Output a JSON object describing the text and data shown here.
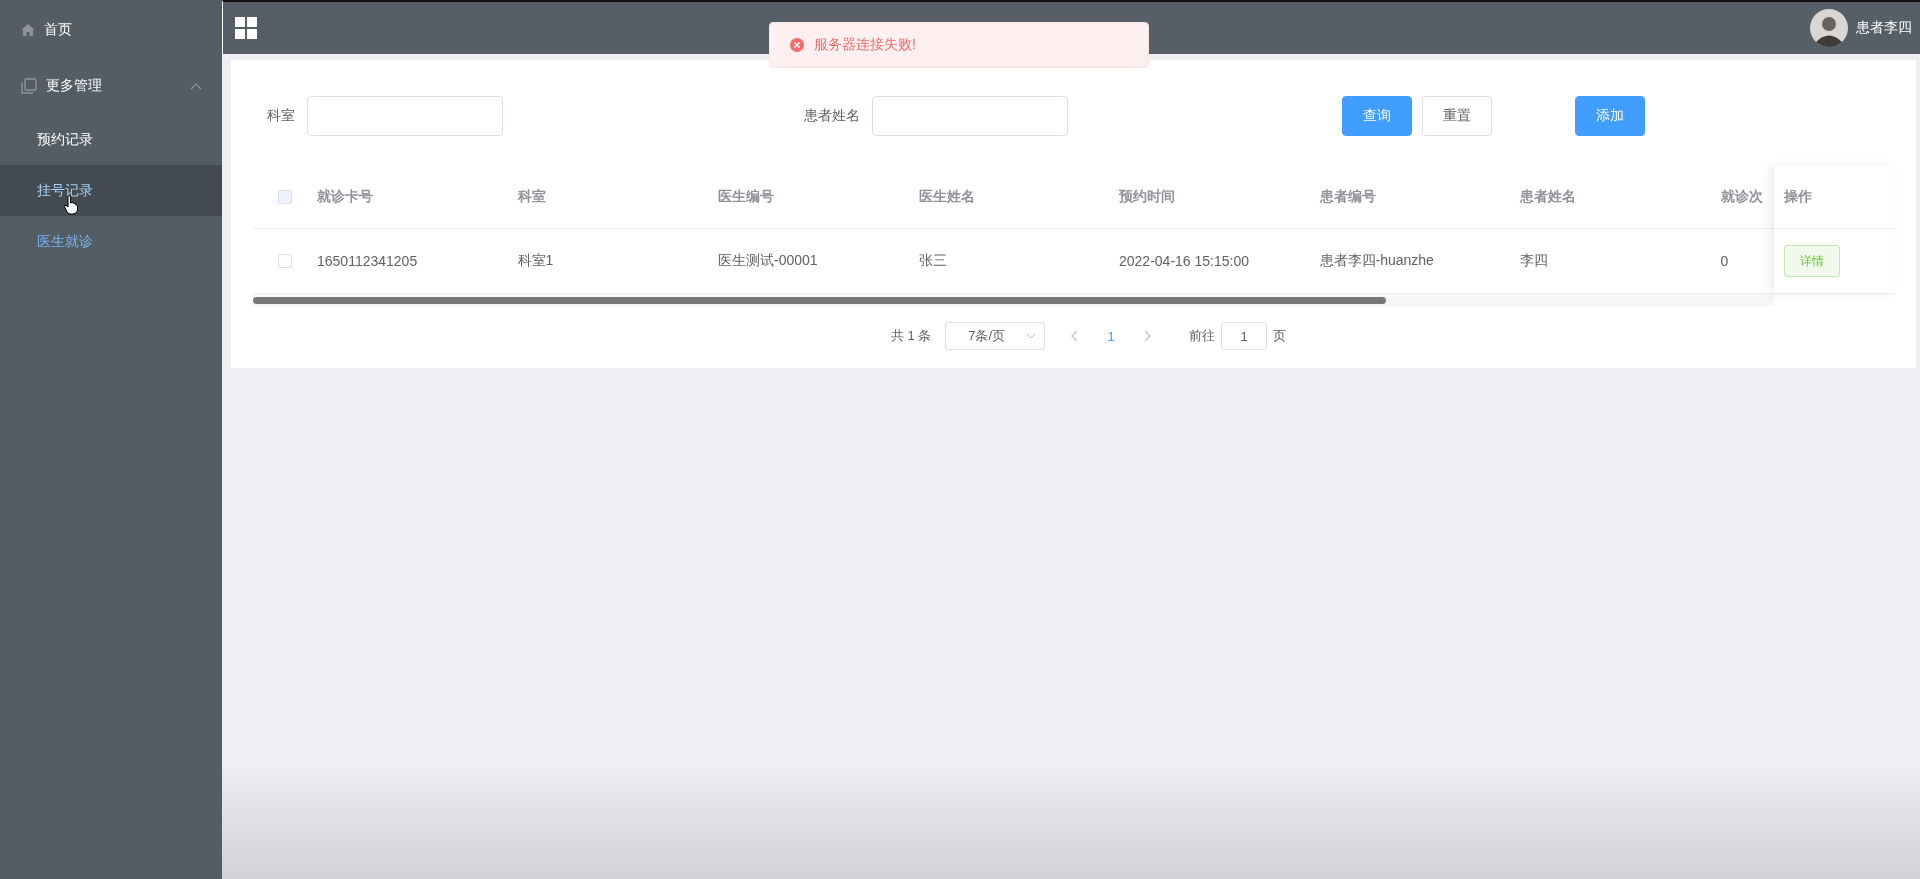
{
  "sidebar": {
    "items": [
      {
        "label": "首页",
        "selected": false,
        "hovered": false
      },
      {
        "label": "更多管理",
        "expanded": true,
        "selected": false,
        "hovered": false,
        "children": [
          {
            "label": "预约记录",
            "selected": false,
            "hovered": false
          },
          {
            "label": "挂号记录",
            "selected": false,
            "hovered": true
          },
          {
            "label": "医生就诊",
            "selected": true,
            "hovered": false
          }
        ]
      }
    ]
  },
  "header": {
    "user": "患者李四"
  },
  "toast": {
    "kind": "error",
    "message": "服务器连接失败!"
  },
  "search": {
    "fields": [
      {
        "label": "科室"
      },
      {
        "label": "患者姓名"
      }
    ],
    "buttons": [
      {
        "label": "查询",
        "kind": "primary"
      },
      {
        "label": "重置",
        "kind": "default"
      },
      {
        "label": "添加",
        "kind": "primary"
      }
    ]
  },
  "table": {
    "columns": [
      "就诊卡号",
      "科室",
      "医生编号",
      "医生姓名",
      "预约时间",
      "患者编号",
      "患者姓名",
      "就诊次"
    ],
    "all_checked": false,
    "action_column": "操作",
    "rows": [
      {
        "checked": false,
        "cells": [
          "1650112341205",
          "科室1",
          "医生测试-00001",
          "张三",
          "2022-04-16 15:15:00",
          "患者李四-huanzhe",
          "李四",
          "0"
        ],
        "action": "详情"
      }
    ]
  },
  "pagination": {
    "total": "共 1 条",
    "page_size": "7条/页",
    "pages": [
      {
        "label": "1",
        "selected": true
      }
    ],
    "goto_label": "前往",
    "goto_value": "1",
    "goto_suffix": "页"
  }
}
